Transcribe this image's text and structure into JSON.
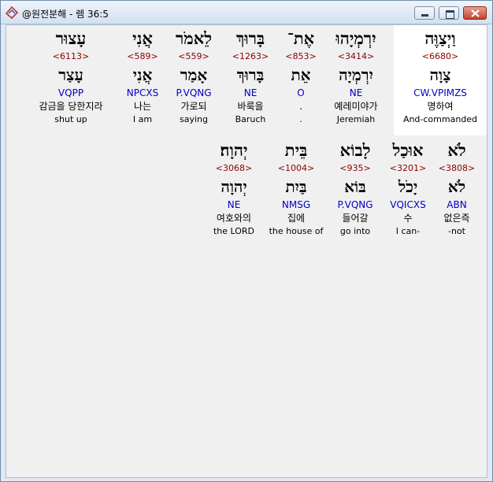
{
  "window": {
    "title": "@원전분해 - 렘 36:5"
  },
  "rows": [
    {
      "words": [
        {
          "heb": "וַיְצַוֶּה",
          "strong": "<6680>",
          "lemma": "צָוָה",
          "morph": "CW.VPIMZS",
          "korean": "명하여",
          "english": "And-commanded"
        },
        {
          "heb": "יִרְמְיָהוּ",
          "strong": "<3414>",
          "lemma": "יִרְמְיָה",
          "morph": "NE",
          "korean": "예레미야가",
          "english": "Jeremiah"
        },
        {
          "heb": "אֶת־",
          "strong": "<853>",
          "lemma": "אֵת",
          "morph": "O",
          "korean": ".",
          "english": "."
        },
        {
          "heb": "בָּרוּךְ",
          "strong": "<1263>",
          "lemma": "בָּרוּךְ",
          "morph": "NE",
          "korean": "바룩을",
          "english": "Baruch"
        },
        {
          "heb": "לֵאמֹר",
          "strong": "<559>",
          "lemma": "אָמַר",
          "morph": "P.VQNG",
          "korean": "가로되",
          "english": "saying"
        },
        {
          "heb": "אֲנִי",
          "strong": "<589>",
          "lemma": "אֲנִי",
          "morph": "NPCXS",
          "korean": "나는",
          "english": "I am"
        },
        {
          "heb": "עָצוּר",
          "strong": "<6113>",
          "lemma": "עָצַר",
          "morph": "VQPP",
          "korean": "감금을 당한지라",
          "english": "shut up"
        }
      ]
    },
    {
      "words": [
        {
          "heb": "לֹא",
          "strong": "<3808>",
          "lemma": "לֹא",
          "morph": "ABN",
          "korean": "없은즉",
          "english": "-not"
        },
        {
          "heb": "אוּכַל",
          "strong": "<3201>",
          "lemma": "יָכֹל",
          "morph": "VQICXS",
          "korean": "수",
          "english": "I can-"
        },
        {
          "heb": "לָבוֹא",
          "strong": "<935>",
          "lemma": "בּוֹא",
          "morph": "P.VQNG",
          "korean": "들어갈",
          "english": "go into"
        },
        {
          "heb": "בֵּית",
          "strong": "<1004>",
          "lemma": "בַּיִת",
          "morph": "NMSG",
          "korean": "집에",
          "english": "the house of"
        },
        {
          "heb": "יְהוָה׃",
          "strong": "<3068>",
          "lemma": "יְהוָה",
          "morph": "NE",
          "korean": "여호와의",
          "english": "the LORD"
        }
      ]
    }
  ]
}
